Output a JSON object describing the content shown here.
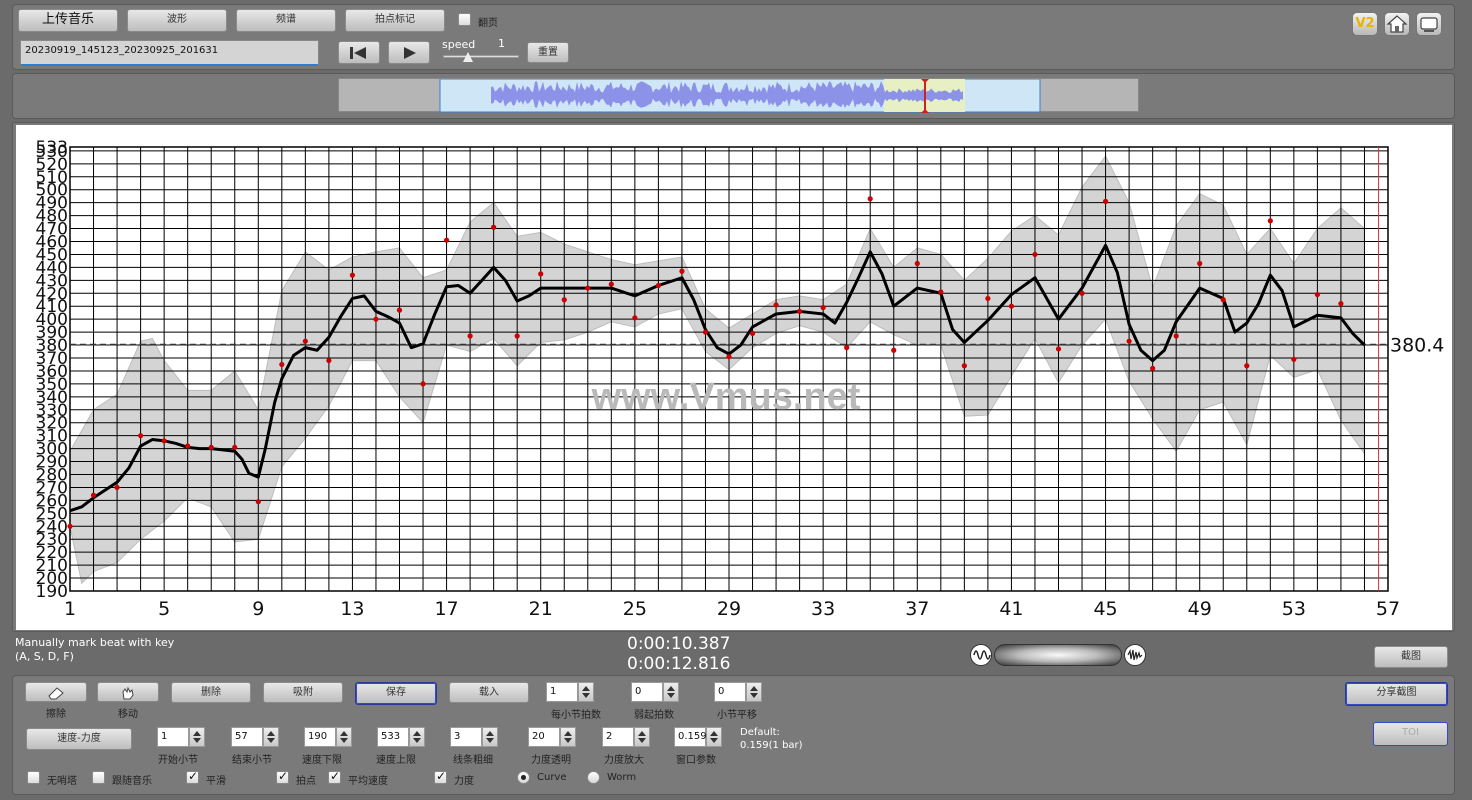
{
  "toolbar": {
    "upload": "上传音乐",
    "waveform": "波形",
    "spectrum": "频谱",
    "beat_mark": "拍点标记",
    "page_flip": "翻页",
    "filename": "20230919_145123_20230925_201631",
    "speed_label": "speed",
    "speed_value": "1",
    "reset": "重置",
    "v2": "V2"
  },
  "chart_data": {
    "type": "line",
    "xlabel": "",
    "ylabel": "",
    "xlim": [
      1,
      57
    ],
    "ylim": [
      190,
      533
    ],
    "x_ticks": [
      1,
      5,
      9,
      13,
      17,
      21,
      25,
      29,
      33,
      37,
      41,
      45,
      49,
      53,
      57
    ],
    "y_ticks": [
      190,
      200,
      210,
      220,
      230,
      240,
      250,
      260,
      270,
      280,
      290,
      300,
      310,
      320,
      330,
      340,
      350,
      360,
      370,
      380,
      390,
      400,
      410,
      420,
      430,
      440,
      450,
      460,
      470,
      480,
      490,
      500,
      510,
      520,
      530,
      533
    ],
    "average": 380.4,
    "average_label": "380.4",
    "watermark": "www.Vmus.net",
    "cursor_x": 56.6,
    "tempo_line": [
      [
        1,
        252
      ],
      [
        1.5,
        255
      ],
      [
        2,
        262
      ],
      [
        2.5,
        268
      ],
      [
        3,
        274
      ],
      [
        3.5,
        285
      ],
      [
        4,
        302
      ],
      [
        4.5,
        307
      ],
      [
        5,
        306
      ],
      [
        5.5,
        304
      ],
      [
        6,
        301
      ],
      [
        6.5,
        300
      ],
      [
        7,
        300
      ],
      [
        7.5,
        299
      ],
      [
        8,
        298
      ],
      [
        8.3,
        292
      ],
      [
        8.6,
        281
      ],
      [
        9,
        278
      ],
      [
        9.3,
        300
      ],
      [
        9.7,
        336
      ],
      [
        10,
        354
      ],
      [
        10.5,
        372
      ],
      [
        11,
        378
      ],
      [
        11.5,
        376
      ],
      [
        12,
        386
      ],
      [
        12.5,
        402
      ],
      [
        13,
        416
      ],
      [
        13.5,
        418
      ],
      [
        14,
        406
      ],
      [
        14.5,
        402
      ],
      [
        15,
        397
      ],
      [
        15.5,
        378
      ],
      [
        16,
        381
      ],
      [
        16.5,
        404
      ],
      [
        17,
        425
      ],
      [
        17.5,
        426
      ],
      [
        18,
        420
      ],
      [
        18.5,
        430
      ],
      [
        19,
        440
      ],
      [
        19.5,
        430
      ],
      [
        20,
        414
      ],
      [
        20.5,
        418
      ],
      [
        21,
        424
      ],
      [
        22,
        424
      ],
      [
        23,
        424
      ],
      [
        24,
        424
      ],
      [
        25,
        418
      ],
      [
        26,
        426
      ],
      [
        27,
        432
      ],
      [
        27.5,
        415
      ],
      [
        28,
        392
      ],
      [
        28.5,
        378
      ],
      [
        29,
        373
      ],
      [
        29.5,
        380
      ],
      [
        30,
        394
      ],
      [
        31,
        404
      ],
      [
        32,
        406
      ],
      [
        32.5,
        405
      ],
      [
        33,
        404
      ],
      [
        33.5,
        397
      ],
      [
        34,
        413
      ],
      [
        34.5,
        432
      ],
      [
        35,
        452
      ],
      [
        35.5,
        435
      ],
      [
        36,
        410
      ],
      [
        37,
        424
      ],
      [
        38,
        420
      ],
      [
        38.5,
        392
      ],
      [
        39,
        382
      ],
      [
        40,
        399
      ],
      [
        41,
        419
      ],
      [
        42,
        432
      ],
      [
        43,
        400
      ],
      [
        44,
        424
      ],
      [
        45,
        457
      ],
      [
        45.5,
        436
      ],
      [
        46,
        396
      ],
      [
        46.5,
        376
      ],
      [
        47,
        368
      ],
      [
        47.5,
        376
      ],
      [
        48,
        398
      ],
      [
        49,
        424
      ],
      [
        50,
        416
      ],
      [
        50.5,
        390
      ],
      [
        51,
        397
      ],
      [
        51.5,
        412
      ],
      [
        52,
        434
      ],
      [
        52.5,
        422
      ],
      [
        53,
        394
      ],
      [
        54,
        403
      ],
      [
        55,
        401
      ],
      [
        55.5,
        389
      ],
      [
        56,
        380
      ]
    ],
    "band_upper": [
      [
        1,
        298
      ],
      [
        2,
        330
      ],
      [
        3,
        342
      ],
      [
        4,
        383
      ],
      [
        4.5,
        385
      ],
      [
        5,
        368
      ],
      [
        6,
        345
      ],
      [
        7,
        345
      ],
      [
        8,
        360
      ],
      [
        9,
        330
      ],
      [
        10,
        422
      ],
      [
        11,
        452
      ],
      [
        12,
        438
      ],
      [
        13,
        448
      ],
      [
        14,
        452
      ],
      [
        15,
        455
      ],
      [
        16,
        432
      ],
      [
        17,
        438
      ],
      [
        18,
        475
      ],
      [
        19,
        490
      ],
      [
        20,
        464
      ],
      [
        21,
        467
      ],
      [
        22,
        458
      ],
      [
        23,
        452
      ],
      [
        24,
        446
      ],
      [
        25,
        442
      ],
      [
        26,
        445
      ],
      [
        27,
        448
      ],
      [
        28,
        408
      ],
      [
        29,
        393
      ],
      [
        30,
        404
      ],
      [
        31,
        415
      ],
      [
        32,
        418
      ],
      [
        33,
        415
      ],
      [
        34,
        427
      ],
      [
        35,
        470
      ],
      [
        36,
        440
      ],
      [
        37,
        455
      ],
      [
        38,
        450
      ],
      [
        39,
        430
      ],
      [
        40,
        447
      ],
      [
        41,
        468
      ],
      [
        42,
        480
      ],
      [
        43,
        465
      ],
      [
        44,
        502
      ],
      [
        45,
        526
      ],
      [
        46,
        490
      ],
      [
        47,
        424
      ],
      [
        48,
        472
      ],
      [
        49,
        497
      ],
      [
        50,
        488
      ],
      [
        51,
        450
      ],
      [
        52,
        470
      ],
      [
        53,
        443
      ],
      [
        54,
        470
      ],
      [
        55,
        486
      ],
      [
        56,
        470
      ]
    ],
    "band_lower": [
      [
        1,
        240
      ],
      [
        1.5,
        196
      ],
      [
        2,
        205
      ],
      [
        3,
        212
      ],
      [
        4,
        230
      ],
      [
        5,
        244
      ],
      [
        6,
        262
      ],
      [
        7,
        255
      ],
      [
        8,
        228
      ],
      [
        9,
        230
      ],
      [
        10,
        286
      ],
      [
        11,
        308
      ],
      [
        12,
        333
      ],
      [
        13,
        368
      ],
      [
        14,
        368
      ],
      [
        15,
        340
      ],
      [
        16,
        320
      ],
      [
        17,
        380
      ],
      [
        18,
        375
      ],
      [
        19,
        385
      ],
      [
        20,
        364
      ],
      [
        21,
        382
      ],
      [
        22,
        384
      ],
      [
        23,
        390
      ],
      [
        24,
        398
      ],
      [
        25,
        394
      ],
      [
        26,
        404
      ],
      [
        27,
        408
      ],
      [
        28,
        375
      ],
      [
        29,
        361
      ],
      [
        30,
        378
      ],
      [
        31,
        389
      ],
      [
        32,
        395
      ],
      [
        33,
        390
      ],
      [
        34,
        378
      ],
      [
        35,
        398
      ],
      [
        36,
        388
      ],
      [
        37,
        380
      ],
      [
        38,
        380
      ],
      [
        39,
        325
      ],
      [
        40,
        326
      ],
      [
        41,
        356
      ],
      [
        42,
        385
      ],
      [
        43,
        351
      ],
      [
        44,
        380
      ],
      [
        45,
        400
      ],
      [
        46,
        352
      ],
      [
        47,
        323
      ],
      [
        48,
        298
      ],
      [
        49,
        330
      ],
      [
        50,
        336
      ],
      [
        51,
        303
      ],
      [
        52,
        372
      ],
      [
        53,
        355
      ],
      [
        54,
        361
      ],
      [
        55,
        322
      ],
      [
        56,
        296
      ]
    ],
    "beat_points": [
      [
        1,
        240
      ],
      [
        2,
        264
      ],
      [
        3,
        270
      ],
      [
        4,
        310
      ],
      [
        5,
        306
      ],
      [
        6,
        302
      ],
      [
        7,
        301
      ],
      [
        8,
        301
      ],
      [
        9,
        259
      ],
      [
        10,
        365
      ],
      [
        11,
        383
      ],
      [
        12,
        368
      ],
      [
        13,
        434
      ],
      [
        14,
        400
      ],
      [
        15,
        407
      ],
      [
        16,
        350
      ],
      [
        17,
        461
      ],
      [
        18,
        387
      ],
      [
        19,
        471
      ],
      [
        20,
        387
      ],
      [
        21,
        435
      ],
      [
        22,
        415
      ],
      [
        23,
        424
      ],
      [
        24,
        427
      ],
      [
        25,
        401
      ],
      [
        26,
        426
      ],
      [
        27,
        437
      ],
      [
        28,
        390
      ],
      [
        29,
        371
      ],
      [
        30,
        389
      ],
      [
        31,
        411
      ],
      [
        32,
        406
      ],
      [
        33,
        409
      ],
      [
        34,
        378
      ],
      [
        35,
        493
      ],
      [
        36,
        376
      ],
      [
        37,
        443
      ],
      [
        38,
        421
      ],
      [
        39,
        364
      ],
      [
        40,
        416
      ],
      [
        41,
        410
      ],
      [
        42,
        450
      ],
      [
        43,
        377
      ],
      [
        44,
        420
      ],
      [
        45,
        491
      ],
      [
        46,
        383
      ],
      [
        47,
        362
      ],
      [
        48,
        387
      ],
      [
        49,
        443
      ],
      [
        50,
        415
      ],
      [
        51,
        364
      ],
      [
        52,
        476
      ],
      [
        53,
        369
      ],
      [
        54,
        419
      ],
      [
        55,
        412
      ]
    ]
  },
  "status": {
    "hint_line1": "Manually mark beat with key",
    "hint_line2": "(A, S, D, F)",
    "time_current": "0:00:10.387",
    "time_total": "0:00:12.816",
    "screenshot": "截图"
  },
  "controls": {
    "erase": "擦除",
    "move": "移动",
    "delete": "删除",
    "snap": "吸附",
    "save": "保存",
    "load": "载入",
    "beats_per_bar_label": "每小节拍数",
    "beats_per_bar": "1",
    "weak_beat_label": "弱起拍数",
    "weak_beat": "0",
    "bar_shift_label": "小节平移",
    "bar_shift": "0",
    "share_screenshot": "分享截图",
    "tempo_dynamics": "速度-力度",
    "start_bar_label": "开始小节",
    "start_bar": "1",
    "end_bar_label": "结束小节",
    "end_bar": "57",
    "tempo_min_label": "速度下限",
    "tempo_min": "190",
    "tempo_max_label": "速度上限",
    "tempo_max": "533",
    "line_width_label": "线条粗细",
    "line_width": "3",
    "dyn_opacity_label": "力度透明",
    "dyn_opacity": "20",
    "dyn_scale_label": "力度放大",
    "dyn_scale": "2",
    "window_param_label": "窗口参数",
    "window_param": "0.159",
    "default_line1": "Default:",
    "default_line2": "0.159(1 bar)",
    "toi": "TOI",
    "no_metronome": "无哨塔",
    "follow_music": "跟随音乐",
    "smooth": "平滑",
    "beat_points": "拍点",
    "avg_tempo": "平均速度",
    "dynamics": "力度",
    "curve": "Curve",
    "worm": "Worm"
  }
}
